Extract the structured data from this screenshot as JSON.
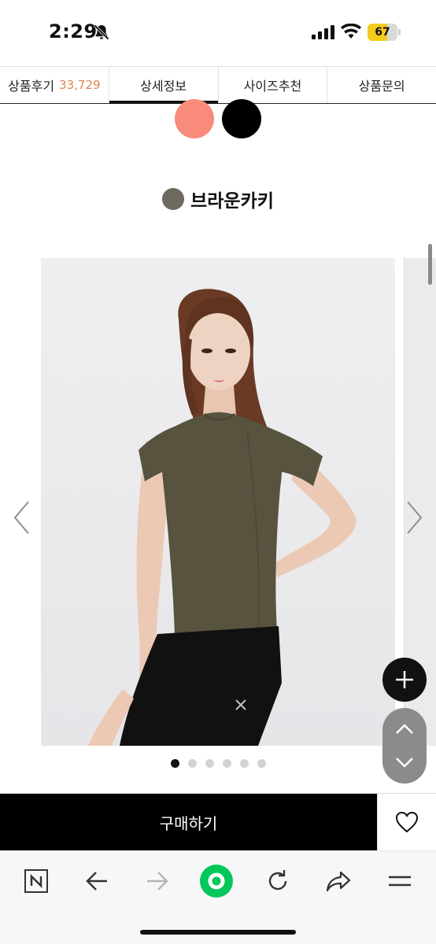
{
  "status_bar": {
    "time": "2:29",
    "battery_level": "67",
    "battery_fraction": 0.67,
    "icons": [
      "bell-slash-icon",
      "cellular-signal-icon",
      "wifi-icon",
      "battery-icon"
    ]
  },
  "tabs": [
    {
      "label": "상품후기",
      "count": "33,729",
      "active": false
    },
    {
      "label": "상세정보",
      "count": "",
      "active": true
    },
    {
      "label": "사이즈추천",
      "count": "",
      "active": false
    },
    {
      "label": "상품문의",
      "count": "",
      "active": false
    }
  ],
  "swatches": [
    {
      "name": "coral",
      "color": "#f98b7a"
    },
    {
      "name": "black",
      "color": "#000000"
    }
  ],
  "color_section": {
    "name": "브라운카키",
    "color": "#6d6a5d"
  },
  "carousel": {
    "slide_count": 6,
    "active_index": 0,
    "prev_icon": "chevron-left-icon",
    "next_icon": "chevron-right-icon"
  },
  "buy_bar": {
    "buy_label": "구매하기",
    "wish_icon": "heart-icon"
  },
  "floating": {
    "plus_icon": "plus-icon",
    "up_icon": "chevron-up-icon",
    "down_icon": "chevron-down-icon"
  },
  "browser_toolbar": {
    "items": [
      "naver-n-icon",
      "back-arrow-icon",
      "forward-arrow-icon",
      "green-home-icon",
      "reload-icon",
      "share-icon",
      "menu-icon"
    ]
  },
  "colors": {
    "accent_count": "#e0844f",
    "green": "#03c75a",
    "khaki": "#58533f"
  }
}
